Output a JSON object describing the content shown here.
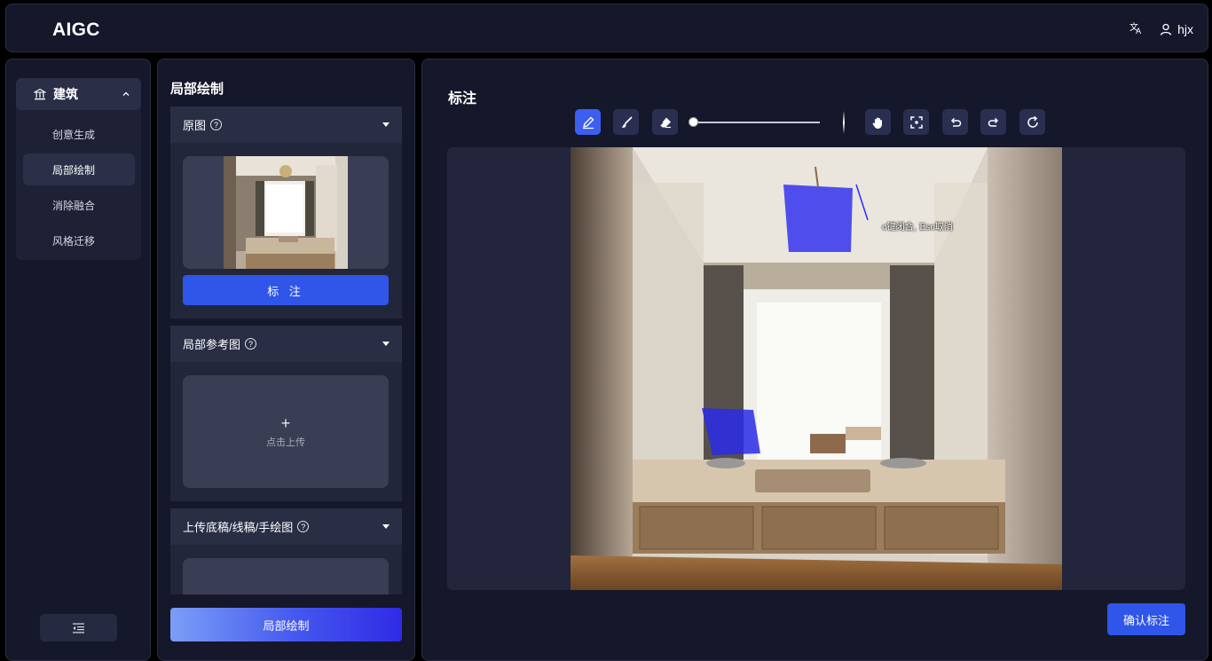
{
  "header": {
    "logo": "AIGC",
    "translate_icon": "translate-icon",
    "user_icon": "user-icon",
    "username": "hjx"
  },
  "sidebar": {
    "group": {
      "icon": "building-icon",
      "label": "建筑",
      "chevron": "chevron-up-icon"
    },
    "items": [
      {
        "label": "创意生成",
        "active": false
      },
      {
        "label": "局部绘制",
        "active": true
      },
      {
        "label": "消除融合",
        "active": false
      },
      {
        "label": "风格迁移",
        "active": false
      }
    ],
    "collapse_icon": "collapse-menu-icon"
  },
  "panel": {
    "title": "局部绘制",
    "sections": [
      {
        "title": "原图",
        "help": "?",
        "mark_button": "标 注"
      },
      {
        "title": "局部参考图",
        "help": "?",
        "upload_plus": "+",
        "upload_text": "点击上传"
      },
      {
        "title": "上传底稿/线稿/手绘图",
        "help": "?"
      }
    ],
    "generate_button": "局部绘制"
  },
  "main": {
    "title": "标注",
    "tools": [
      "pen-icon",
      "brush-icon",
      "eraser-icon",
      "hand-icon",
      "fit-screen-icon",
      "undo-icon",
      "redo-icon",
      "reset-icon"
    ],
    "brush_size": 0,
    "canvas_hint": "c键闭合, Esc取消",
    "confirm_button": "确认标注"
  },
  "colors": {
    "accent": "#2f56e8",
    "tool_active": "#3c5ff0",
    "mask": "#2626ff"
  }
}
